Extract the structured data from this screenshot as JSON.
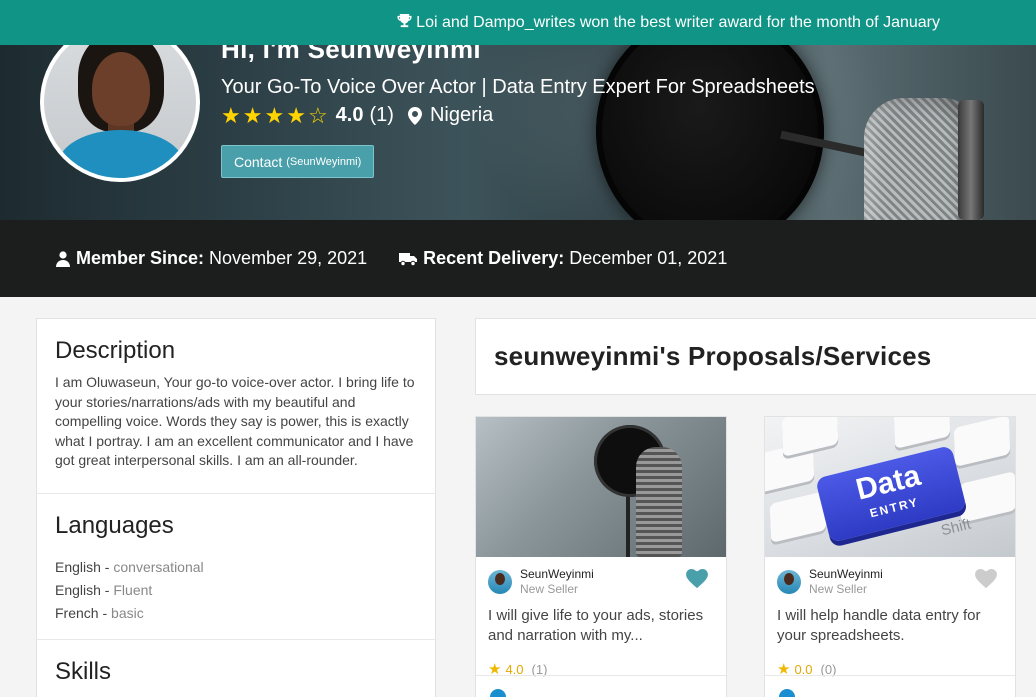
{
  "announcement": {
    "icon": "trophy-icon",
    "text": "Loi and Dampo_writes won the best writer award for the month of January"
  },
  "profile": {
    "title": "Hi, I'm SeunWeyinmi",
    "tagline": "Your Go-To Voice Over Actor | Data Entry Expert For Spreadsheets",
    "rating": 4.0,
    "rating_display": "4.0",
    "rating_count": "(1)",
    "stars_filled": 4,
    "stars_total": 5,
    "location": "Nigeria",
    "contact_label": "Contact",
    "contact_username": "(SeunWeyinmi)"
  },
  "stats": {
    "member_since_label": "Member Since:",
    "member_since_value": "November 29, 2021",
    "recent_delivery_label": "Recent Delivery:",
    "recent_delivery_value": "December 01, 2021"
  },
  "description": {
    "heading": "Description",
    "text": "I am Oluwaseun, Your go-to voice-over actor. I bring life to your stories/narrations/ads with my beautiful and compelling voice. Words they say is power, this is exactly what I portray. I am an excellent communicator and I have got great interpersonal skills. I am an all-rounder."
  },
  "languages": {
    "heading": "Languages",
    "items": [
      {
        "name": "English",
        "level": "conversational"
      },
      {
        "name": "English",
        "level": "Fluent"
      },
      {
        "name": "French",
        "level": "basic"
      }
    ]
  },
  "skills": {
    "heading": "Skills"
  },
  "services": {
    "heading": "seunweyinmi's Proposals/Services",
    "cards": [
      {
        "seller": "SeunWeyinmi",
        "level": "New Seller",
        "title": "I will give life to your ads, stories and narration with my...",
        "rating": "4.0",
        "count": "(1)",
        "favorited": true
      },
      {
        "seller": "SeunWeyinmi",
        "level": "New Seller",
        "title": "I will help handle data entry for your spreadsheets.",
        "rating": "0.0",
        "count": "(0)",
        "favorited": false,
        "image_text_main": "Data",
        "image_text_sub": "ENTRY",
        "image_text_key": "Shift"
      }
    ]
  },
  "colors": {
    "announcement_bg": "#0f9486",
    "contact_button": "#4aa0aa",
    "star": "#ffd400",
    "heart_active": "#4aa0aa",
    "heart_inactive": "#cccccc"
  }
}
